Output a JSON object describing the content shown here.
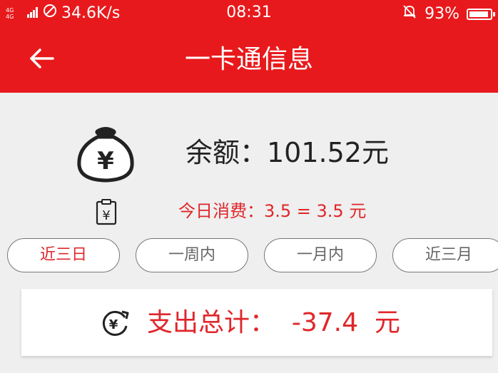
{
  "status_bar": {
    "network_label": "4G 4G",
    "speed": "34.6K/s",
    "time": "08:31",
    "battery": "93%",
    "battery_level": 0.93
  },
  "header": {
    "title": "一卡通信息",
    "back_icon": "arrow-left-icon"
  },
  "balance": {
    "text": "余额：101.52元",
    "icon": "money-bag-icon"
  },
  "today": {
    "text": "今日消费：3.5 = 3.5 元",
    "icon": "clipboard-yen-icon"
  },
  "tabs": [
    {
      "label": "近三日",
      "active": true
    },
    {
      "label": "一周内",
      "active": false
    },
    {
      "label": "一月内",
      "active": false
    },
    {
      "label": "近三月",
      "active": false
    }
  ],
  "summary": {
    "text": "支出总计：  -37.4  元",
    "icon": "yen-expense-icon"
  },
  "colors": {
    "brand_red": "#e8191c",
    "text_red": "#e0262a",
    "background": "#efefef"
  }
}
